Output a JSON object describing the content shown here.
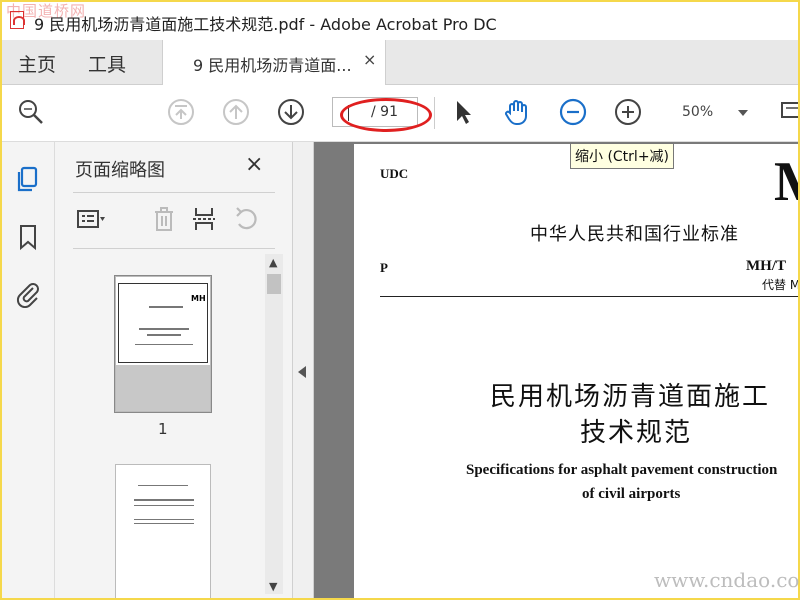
{
  "window": {
    "title": "9 民用机场沥青道面施工技术规范.pdf - Adobe Acrobat Pro DC",
    "watermark_top": "中国道桥网"
  },
  "tabs": {
    "home": "主页",
    "tools": "工具",
    "document": "9 民用机场沥青道面...",
    "close": "×"
  },
  "toolbar": {
    "page_count": "/ 91",
    "zoom": "50%",
    "tooltip": "缩小 (Ctrl+减)"
  },
  "panel": {
    "title": "页面缩略图",
    "close": "×",
    "thumbnail_1_label": "1",
    "thumb_mark": "MH"
  },
  "scrollbar": {
    "up": "▲",
    "down": "▼"
  },
  "document": {
    "udc": "UDC",
    "big_letter": "M",
    "industry_standard": "中华人民共和国行业标准",
    "p_code": "P",
    "standard_code": "MH/T",
    "replaces": "代替 M",
    "title_line1": "民用机场沥青道面施工",
    "title_line2": "技术规范",
    "english_line1": "Specifications for asphalt pavement construction",
    "english_line2": "of civil airports"
  },
  "watermark_bottom": "www.cndao.com",
  "colors": {
    "frame": "#f5d84b",
    "accent_blue": "#1a6fc9",
    "annotation_red": "#e02020"
  }
}
